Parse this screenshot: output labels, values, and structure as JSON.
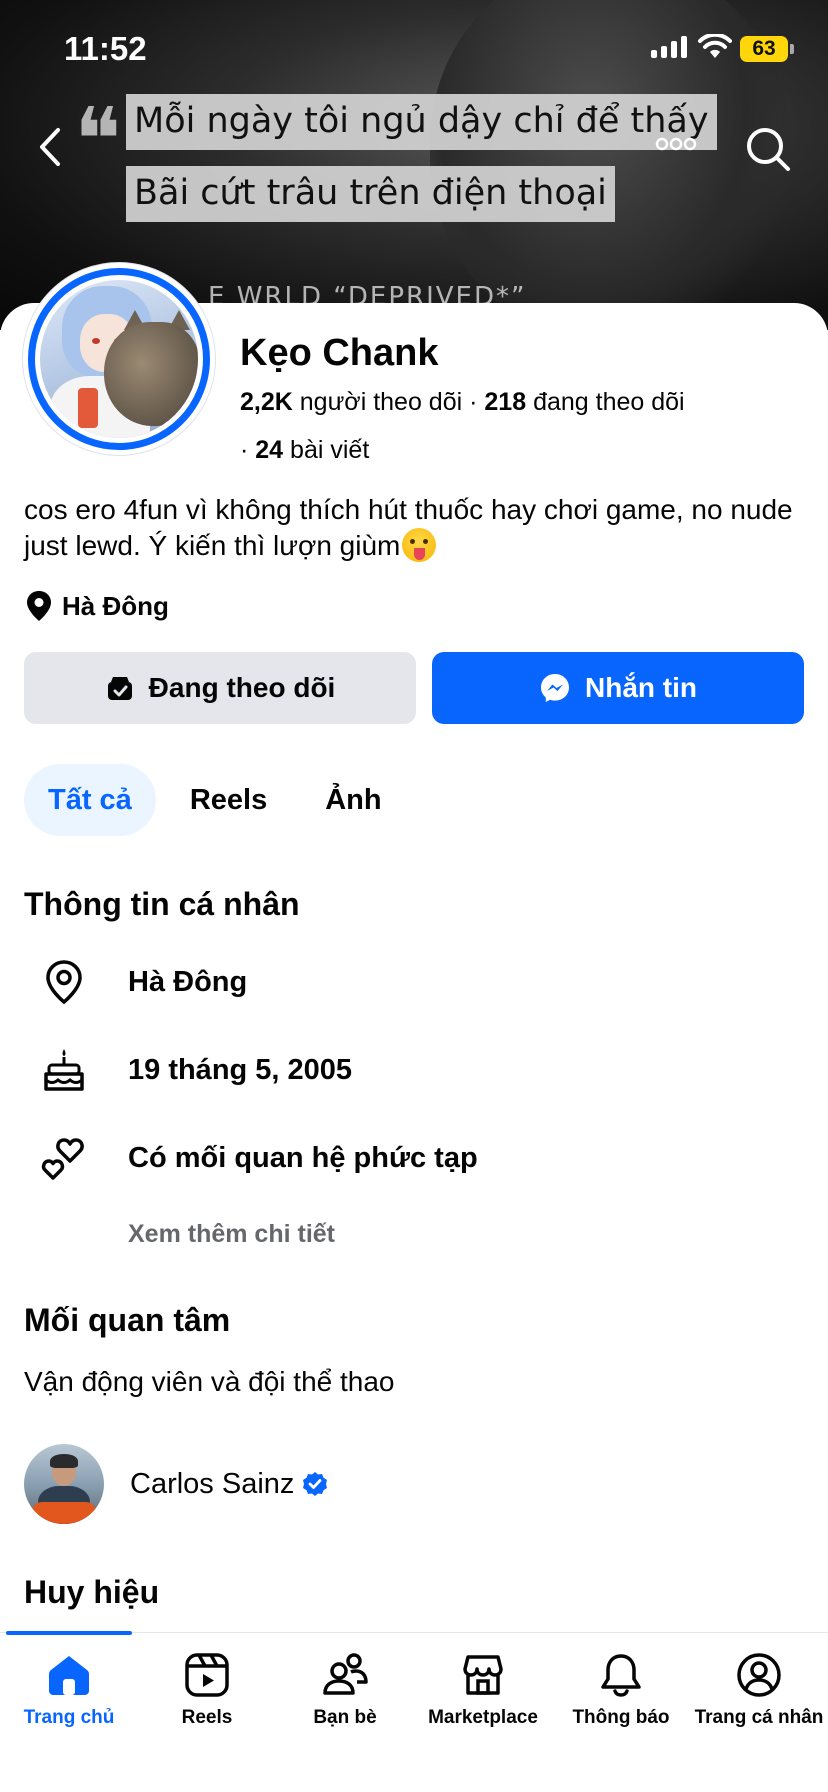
{
  "status_bar": {
    "time": "11:52",
    "battery": "63"
  },
  "cover": {
    "caption_line_1": "Mỗi ngày tôi ngủ dậy chỉ để thấy",
    "caption_line_2": "Bãi cứt trâu trên điện thoại",
    "background_text": "E WRLD “DEPRIVED*”"
  },
  "profile": {
    "name": "Kẹo Chank",
    "followers_count": "2,2K",
    "followers_label": "người theo dõi",
    "following_count": "218",
    "following_label": "đang theo dõi",
    "posts_count": "24",
    "posts_label": "bài viết",
    "bio": "cos ero 4fun vì không thích hút thuốc hay chơi game, no nude just lewd. Ý kiến thì lượn giùm",
    "location": "Hà Đông"
  },
  "actions": {
    "following_label": "Đang theo dõi",
    "message_label": "Nhắn tin"
  },
  "tabs": [
    {
      "label": "Tất cả",
      "active": true
    },
    {
      "label": "Reels",
      "active": false
    },
    {
      "label": "Ảnh",
      "active": false
    }
  ],
  "personal_info": {
    "title": "Thông tin cá nhân",
    "location": "Hà Đông",
    "birthday": "19 tháng 5, 2005",
    "relationship": "Có mối quan hệ phức tạp",
    "see_more": "Xem thêm chi tiết"
  },
  "interests": {
    "title": "Mối quan tâm",
    "category": "Vận động viên và đội thể thao",
    "items": [
      {
        "name": "Carlos Sainz",
        "verified": true
      }
    ]
  },
  "badges": {
    "title": "Huy hiệu"
  },
  "bottom_nav": [
    {
      "label": "Trang chủ",
      "icon": "home-icon",
      "active": true
    },
    {
      "label": "Reels",
      "icon": "reels-icon",
      "active": false
    },
    {
      "label": "Bạn bè",
      "icon": "friends-icon",
      "active": false
    },
    {
      "label": "Marketplace",
      "icon": "marketplace-icon",
      "active": false
    },
    {
      "label": "Thông báo",
      "icon": "bell-icon",
      "active": false
    },
    {
      "label": "Trang cá nhân",
      "icon": "profile-icon",
      "active": false
    }
  ],
  "colors": {
    "accent": "#0866ff",
    "secondary_button": "#e4e6eb",
    "active_tab_bg": "#ebf5ff",
    "muted_text": "#65676b"
  }
}
